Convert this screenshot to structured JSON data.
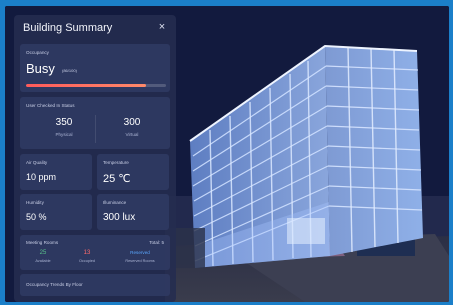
{
  "panel": {
    "title": "Building Summary",
    "close_glyph": "×"
  },
  "occupancy": {
    "label": "Occupancy",
    "status": "Busy",
    "status_note": "(86/100)",
    "level": 0.86,
    "bar_color": "#ff5a5a"
  },
  "checked_in": {
    "label": "User Checked In Status",
    "physical_value": "350",
    "physical_label": "Physical",
    "virtual_value": "300",
    "virtual_label": "Virtual"
  },
  "air_quality": {
    "label": "Air Quality",
    "value": "10 ppm"
  },
  "temperature": {
    "label": "Temperature",
    "value": "25 ℃"
  },
  "humidity": {
    "label": "Humidity",
    "value": "50 %"
  },
  "illuminance": {
    "label": "Illuminance",
    "value": "300 lux"
  },
  "meeting_rooms": {
    "label": "Meeting Rooms",
    "total": "Total: 5",
    "available_value": "25",
    "available_label": "Available",
    "occupied_value": "13",
    "occupied_label": "Occupied",
    "reserved_value": "Reserved",
    "reserved_label": "Reserved Rooms"
  },
  "trends": {
    "label": "Occupancy Trends By Floor"
  },
  "colors": {
    "accent_blue": "#1b7fc9",
    "panel_bg": "#242c50",
    "available": "#58c08a",
    "occupied": "#ff6b6b",
    "reserved": "#5aa7ff"
  }
}
